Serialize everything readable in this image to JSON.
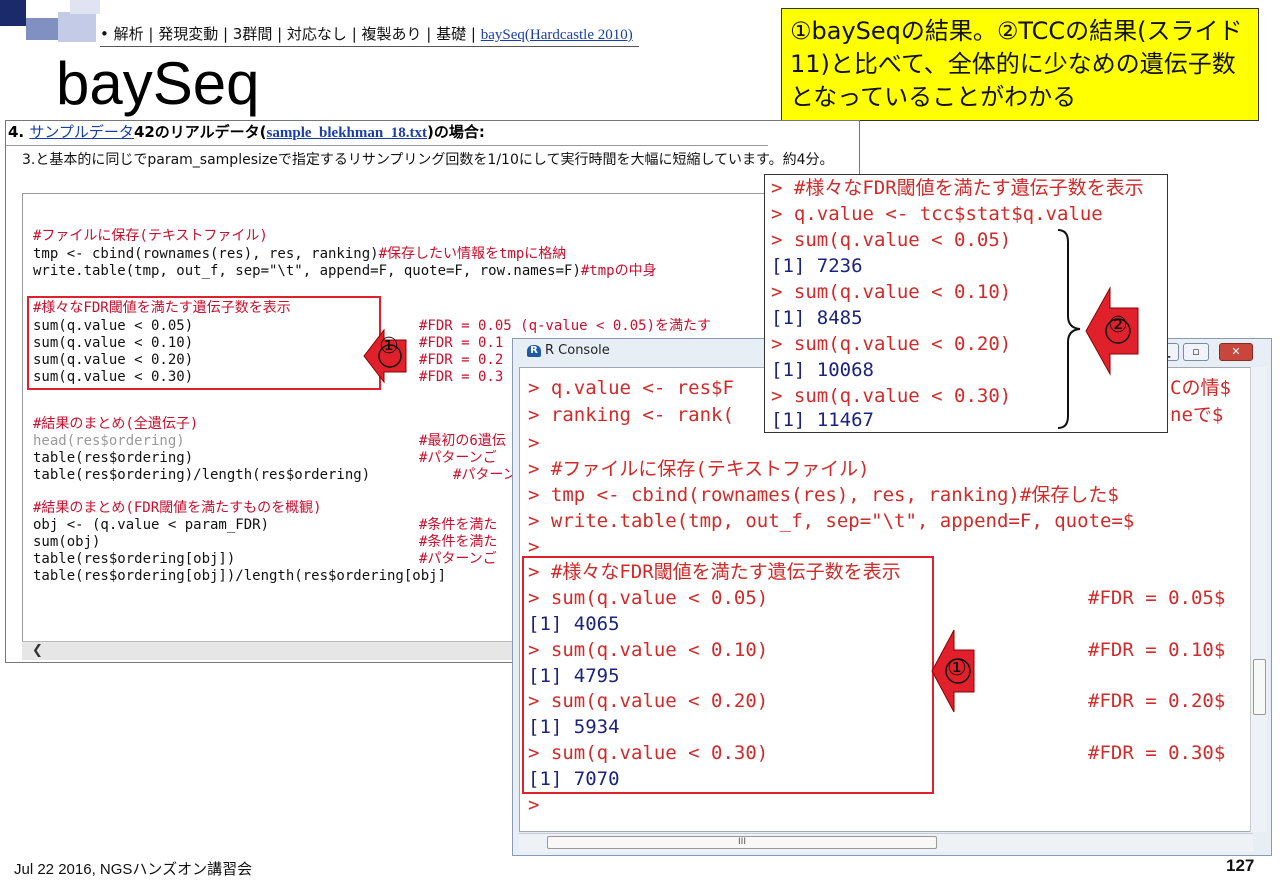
{
  "header": {
    "breadcrumb_prefix": "• 解析 | 発現変動 | 3群間 | 対応なし | 複製あり | 基礎 | ",
    "breadcrumb_link": "baySeq(Hardcastle 2010)",
    "title": "baySeq"
  },
  "note": {
    "text": "①baySeqの結果。②TCCの結果(スライド11)と比べて、全体的に少なめの遺伝子数となっていることがわかる"
  },
  "webpage": {
    "heading_num": "4.",
    "heading_link": "サンプルデータ",
    "heading_mid": "42のリアルデータ(",
    "heading_file": "sample_blekhman_18.txt",
    "heading_end": ")の場合:",
    "description": "3.と基本的に同じでparam_samplesizeで指定するリサンプリング回数を1/10にして実行時間を大幅に短縮しています。約4分。",
    "code": {
      "c_save": "#ファイルに保存(テキストファイル)",
      "l_tmp_a": "tmp <- cbind(rownames(res), res, ranking)",
      "l_tmp_b": "#保存したい情報をtmpに格納",
      "l_write_a": "write.table(tmp, out_f, sep=\"\\t\", append=F, quote=F, row.names=F)",
      "l_write_b": "#tmpの中身",
      "c_fdr": "#様々なFDR閾値を満たす遺伝子数を表示",
      "l_s05": "sum(q.value < 0.05)",
      "l_s10": "sum(q.value < 0.10)",
      "l_s20": "sum(q.value < 0.20)",
      "l_s30": "sum(q.value < 0.30)",
      "f05": "#FDR = 0.05 (q-value < 0.05)を満たす",
      "f10": "#FDR = 0.1",
      "f20": "#FDR = 0.2",
      "f30": "#FDR = 0.3",
      "c_sum_all": "#結果のまとめ(全遺伝子)",
      "l_head": "head(res$ordering)",
      "l_head_c": "#最初の6遺伝",
      "l_table": "table(res$ordering)",
      "l_table_c": "#パターンご",
      "l_table2": "table(res$ordering)/length(res$ordering)",
      "l_table2_c": "#パターン",
      "c_sum_fdr": "#結果のまとめ(FDR閾値を満たすものを概観)",
      "l_obj": "obj <- (q.value < param_FDR)",
      "l_obj_c": "#条件を満た",
      "l_sumobj": "sum(obj)",
      "l_sumobj_c": "#条件を満た",
      "l_tobj": "table(res$ordering[obj])",
      "l_tobj_c": "#パターンご",
      "l_tobj2": "table(res$ordering[obj])/length(res$ordering[obj]"
    }
  },
  "rconsole": {
    "title": "R Console",
    "lines": {
      "l1": "> q.value <- res$F",
      "l1_tail": "Cの情$",
      "l2": "> ranking <- rank(",
      "l2_tail": "neで$",
      "l3": ">",
      "l4": "> #ファイルに保存(テキストファイル)",
      "l5": "> tmp <- cbind(rownames(res), res, ranking)#保存した$",
      "l6": "> write.table(tmp, out_f, sep=\"\\t\", append=F, quote=$",
      "l7": ">",
      "l8": "> #様々なFDR閾値を満たす遺伝子数を表示",
      "l9": "> sum(q.value < 0.05)",
      "l9c": "#FDR = 0.05$",
      "l10": "[1] 4065",
      "l11": "> sum(q.value < 0.10)",
      "l11c": "#FDR = 0.10$",
      "l12": "[1] 4795",
      "l13": "> sum(q.value < 0.20)",
      "l13c": "#FDR = 0.20$",
      "l14": "[1] 5934",
      "l15": "> sum(q.value < 0.30)",
      "l15c": "#FDR = 0.30$",
      "l16": "[1] 7070",
      "l17": ">"
    }
  },
  "overlay": {
    "l1": "> #様々なFDR閾値を満たす遺伝子数を表示",
    "l2": "> q.value <- tcc$stat$q.value",
    "l3": "> sum(q.value < 0.05)",
    "l4": "[1] 7236",
    "l5": "> sum(q.value < 0.10)",
    "l6": "[1] 8485",
    "l7": "> sum(q.value < 0.20)",
    "l8": "[1] 10068",
    "l9": "> sum(q.value < 0.30)",
    "l10": "[1] 11467"
  },
  "markers": {
    "m1": "①",
    "m2": "②"
  },
  "footer": {
    "left": "Jul 22 2016, NGSハンズオン講習会",
    "page": "127"
  },
  "colors": {
    "accent_red": "#e0202a",
    "note_yellow": "#ffff00",
    "deco_navy": "#1b2a6b"
  }
}
